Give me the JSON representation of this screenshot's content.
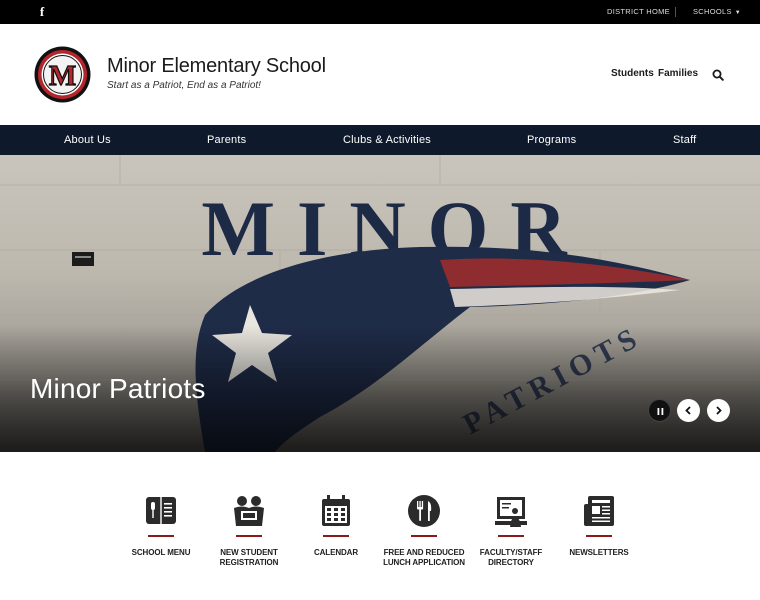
{
  "topbar": {
    "facebook_icon": "facebook-icon",
    "district_home": "DISTRICT HOME",
    "schools": "SCHOOLS"
  },
  "header": {
    "school_name": "Minor Elementary School",
    "tagline": "Start as a Patriot, End as a Patriot!",
    "logo_letter": "M",
    "links": [
      "Students",
      "Families"
    ],
    "search_icon": "search-icon"
  },
  "nav": {
    "items": [
      "About Us",
      "Parents",
      "Clubs & Activities",
      "Programs",
      "Staff"
    ]
  },
  "hero": {
    "title": "Minor Patriots",
    "wall_text": "MINOR",
    "controls": [
      "pause-icon",
      "chevron-left-icon",
      "chevron-right-icon"
    ]
  },
  "quick_links": [
    {
      "label": "School Menu",
      "icon": "menu-book-icon"
    },
    {
      "label": "New Student Registration",
      "icon": "students-icon"
    },
    {
      "label": "Calendar",
      "icon": "calendar-icon"
    },
    {
      "label": "Free and Reduced Lunch Application",
      "icon": "utensils-icon"
    },
    {
      "label": "Faculty/Staff Directory",
      "icon": "directory-icon"
    },
    {
      "label": "Newsletters",
      "icon": "newspaper-icon"
    }
  ],
  "colors": {
    "nav_bg": "#0e1a2b",
    "accent_red": "#8b1a1a",
    "topbar_bg": "#000000"
  }
}
